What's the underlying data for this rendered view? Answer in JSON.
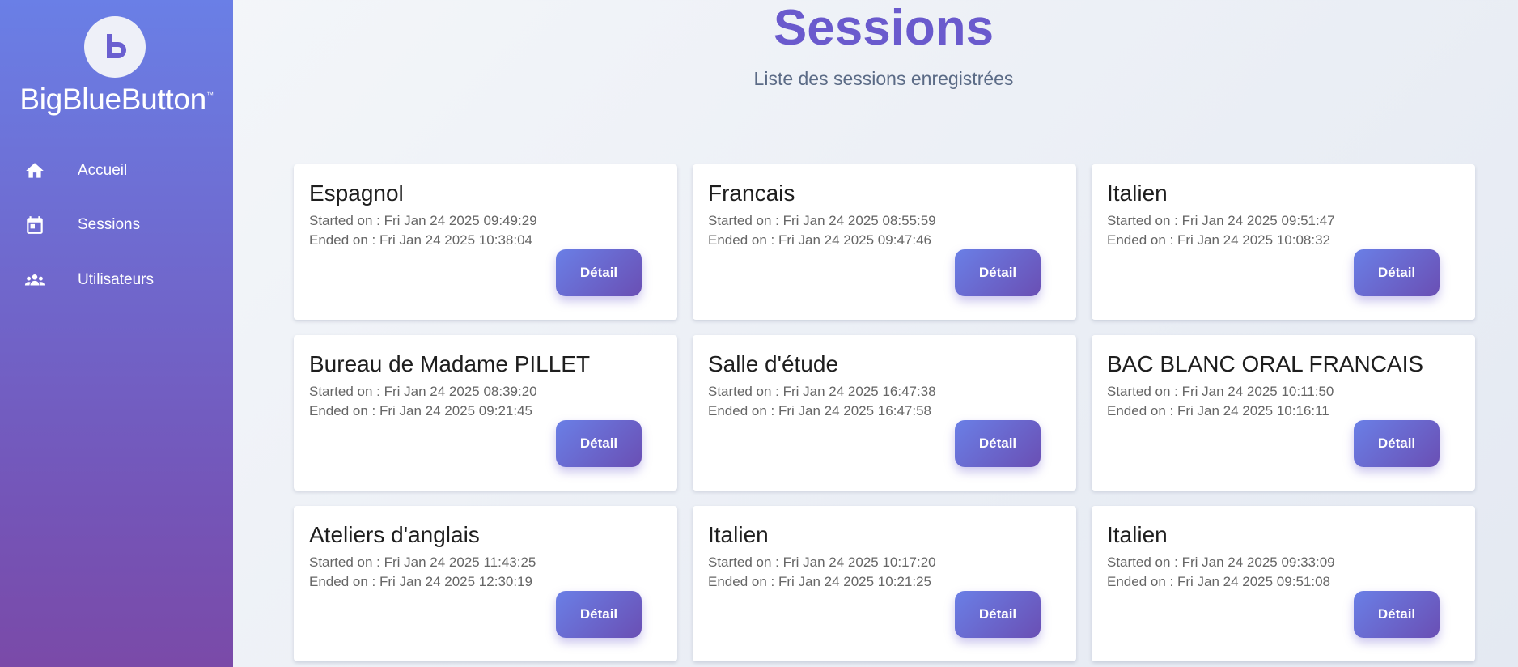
{
  "sidebar": {
    "logo_icon": "bigbluebutton-b-icon",
    "logo_text": "BigBlueButton",
    "logo_tm": "™",
    "items": [
      {
        "label": "Accueil",
        "icon": "home-icon"
      },
      {
        "label": "Sessions",
        "icon": "calendar-icon"
      },
      {
        "label": "Utilisateurs",
        "icon": "users-icon"
      }
    ]
  },
  "header": {
    "title": "Sessions",
    "subtitle": "Liste des sessions enregistrées"
  },
  "sessions": [
    {
      "name": "Espagnol",
      "started": "Started on : Fri Jan 24 2025 09:49:29",
      "ended": "Ended on : Fri Jan 24 2025 10:38:04",
      "button": "Détail"
    },
    {
      "name": "Francais",
      "started": "Started on : Fri Jan 24 2025 08:55:59",
      "ended": "Ended on : Fri Jan 24 2025 09:47:46",
      "button": "Détail"
    },
    {
      "name": "Italien",
      "started": "Started on : Fri Jan 24 2025 09:51:47",
      "ended": "Ended on : Fri Jan 24 2025 10:08:32",
      "button": "Détail"
    },
    {
      "name": "Bureau de Madame PILLET",
      "started": "Started on : Fri Jan 24 2025 08:39:20",
      "ended": "Ended on : Fri Jan 24 2025 09:21:45",
      "button": "Détail"
    },
    {
      "name": "Salle d'étude",
      "started": "Started on : Fri Jan 24 2025 16:47:38",
      "ended": "Ended on : Fri Jan 24 2025 16:47:58",
      "button": "Détail"
    },
    {
      "name": "BAC BLANC ORAL FRANCAIS",
      "started": "Started on : Fri Jan 24 2025 10:11:50",
      "ended": "Ended on : Fri Jan 24 2025 10:16:11",
      "button": "Détail"
    },
    {
      "name": "Ateliers d'anglais",
      "started": "Started on : Fri Jan 24 2025 11:43:25",
      "ended": "Ended on : Fri Jan 24 2025 12:30:19",
      "button": "Détail"
    },
    {
      "name": "Italien",
      "started": "Started on : Fri Jan 24 2025 10:17:20",
      "ended": "Ended on : Fri Jan 24 2025 10:21:25",
      "button": "Détail"
    },
    {
      "name": "Italien",
      "started": "Started on : Fri Jan 24 2025 09:33:09",
      "ended": "Ended on : Fri Jan 24 2025 09:51:08",
      "button": "Détail"
    }
  ],
  "colors": {
    "accent": "#6a5acd",
    "sidebar_top": "#6a7fe6",
    "sidebar_bottom": "#7a4aa8"
  }
}
